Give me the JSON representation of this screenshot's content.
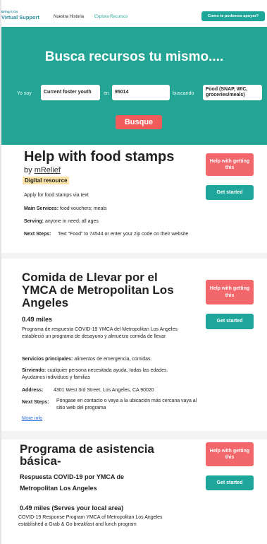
{
  "nav": {
    "logo_top": "Bring it On",
    "logo_main": "Virtual Support",
    "links": [
      "Nuestra Historia",
      "Explora Recursos"
    ],
    "cta": "Como te podemos apoyar?"
  },
  "hero": {
    "title": "Busca recursos tu mismo....",
    "label_yo_soy": "Yo soy",
    "value_who": "Current foster youth",
    "label_en": "en",
    "value_zip": "95014",
    "label_buscando": "buscando",
    "value_need": "Food (SNAP, WIC, groceries/meals)",
    "button": "Busque"
  },
  "cards": [
    {
      "title": "Help with food stamps",
      "by_prefix": "by",
      "by_org": "mRelief",
      "tag": "Digital resource",
      "desc": "Apply for food stamps via text",
      "services_label": "Main Services:",
      "services": "food vouchers; meals",
      "serving_label": "Serving:",
      "serving": "anyone in need; all ages",
      "next_label": "Next Steps:",
      "next": "Text “Food” to 74544 or enter your zip code on their website",
      "help_btn": "Help with getting this",
      "start_btn": "Get started"
    },
    {
      "title": "Comida de Llevar por el YMCA de Metropolitan Los Angeles",
      "distance": "0.49 miles",
      "desc": "Programa de respuesta COVID-19 YMCA del Metropolitan Los Angeles estableció un programa de desayuno y almuerzo comida de llevar",
      "services_label": "Servicios principales:",
      "services": "alimentos de emergencia, comidas.",
      "serving_label": "Sirviendo:",
      "serving": "cualquier persona necesitada ayuda, todas las edades. Ayudamos individuos y familias",
      "address_label": "Address:",
      "address": "4301 West 3rd Street, Los Angeles, CA 90020",
      "next_label": "Next Steps:",
      "next": "Póngase en contacto o vaya a la ubicación más cercana vaya al sitio web del programa",
      "more": "More info",
      "help_btn": "Help with getting this",
      "start_btn": "Get started"
    },
    {
      "title": "Programa de asistencia básica",
      "title_suffix": "-",
      "subtitle": "Respuesta COVID-19 por YMCA de Metropolitan Los Angeles",
      "distance": "0.49 miles (Serves your local area)",
      "desc": "COVID-19 Response Program YMCA of Metropolitan Los Angeles established a Grab & Go breakfast and lunch program",
      "help_btn": "Help with getting this",
      "start_btn": "Get started"
    }
  ],
  "colors": {
    "teal": "#23a494",
    "red": "#f2676b",
    "tag_yellow": "#fbe3a7",
    "link_blue": "#2a6fd6"
  }
}
